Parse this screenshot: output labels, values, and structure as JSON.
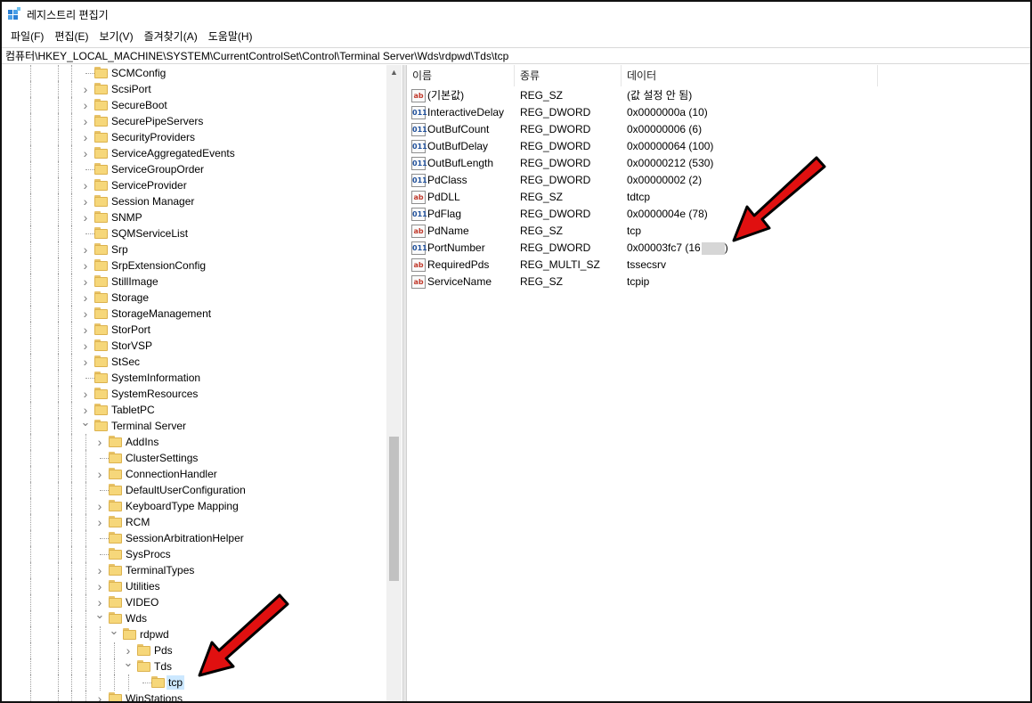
{
  "window": {
    "title": "레지스트리 편집기",
    "app_icon": "registry-editor-icon"
  },
  "menu": [
    "파일(F)",
    "편집(E)",
    "보기(V)",
    "즐겨찾기(A)",
    "도움말(H)"
  ],
  "address": "컴퓨터\\HKEY_LOCAL_MACHINE\\SYSTEM\\CurrentControlSet\\Control\\Terminal Server\\Wds\\rdpwd\\Tds\\tcp",
  "tree": [
    {
      "label": "SCMConfig",
      "depth": 0,
      "expander": "none"
    },
    {
      "label": "ScsiPort",
      "depth": 0,
      "expander": "collapsed"
    },
    {
      "label": "SecureBoot",
      "depth": 0,
      "expander": "collapsed"
    },
    {
      "label": "SecurePipeServers",
      "depth": 0,
      "expander": "collapsed"
    },
    {
      "label": "SecurityProviders",
      "depth": 0,
      "expander": "collapsed"
    },
    {
      "label": "ServiceAggregatedEvents",
      "depth": 0,
      "expander": "collapsed"
    },
    {
      "label": "ServiceGroupOrder",
      "depth": 0,
      "expander": "none"
    },
    {
      "label": "ServiceProvider",
      "depth": 0,
      "expander": "collapsed"
    },
    {
      "label": "Session Manager",
      "depth": 0,
      "expander": "collapsed"
    },
    {
      "label": "SNMP",
      "depth": 0,
      "expander": "collapsed"
    },
    {
      "label": "SQMServiceList",
      "depth": 0,
      "expander": "none"
    },
    {
      "label": "Srp",
      "depth": 0,
      "expander": "collapsed"
    },
    {
      "label": "SrpExtensionConfig",
      "depth": 0,
      "expander": "collapsed"
    },
    {
      "label": "StillImage",
      "depth": 0,
      "expander": "collapsed"
    },
    {
      "label": "Storage",
      "depth": 0,
      "expander": "collapsed"
    },
    {
      "label": "StorageManagement",
      "depth": 0,
      "expander": "collapsed"
    },
    {
      "label": "StorPort",
      "depth": 0,
      "expander": "collapsed"
    },
    {
      "label": "StorVSP",
      "depth": 0,
      "expander": "collapsed"
    },
    {
      "label": "StSec",
      "depth": 0,
      "expander": "collapsed"
    },
    {
      "label": "SystemInformation",
      "depth": 0,
      "expander": "none"
    },
    {
      "label": "SystemResources",
      "depth": 0,
      "expander": "collapsed"
    },
    {
      "label": "TabletPC",
      "depth": 0,
      "expander": "collapsed"
    },
    {
      "label": "Terminal Server",
      "depth": 0,
      "expander": "expanded"
    },
    {
      "label": "AddIns",
      "depth": 1,
      "expander": "collapsed"
    },
    {
      "label": "ClusterSettings",
      "depth": 1,
      "expander": "none"
    },
    {
      "label": "ConnectionHandler",
      "depth": 1,
      "expander": "collapsed"
    },
    {
      "label": "DefaultUserConfiguration",
      "depth": 1,
      "expander": "none"
    },
    {
      "label": "KeyboardType Mapping",
      "depth": 1,
      "expander": "collapsed"
    },
    {
      "label": "RCM",
      "depth": 1,
      "expander": "collapsed"
    },
    {
      "label": "SessionArbitrationHelper",
      "depth": 1,
      "expander": "none"
    },
    {
      "label": "SysProcs",
      "depth": 1,
      "expander": "none"
    },
    {
      "label": "TerminalTypes",
      "depth": 1,
      "expander": "collapsed"
    },
    {
      "label": "Utilities",
      "depth": 1,
      "expander": "collapsed"
    },
    {
      "label": "VIDEO",
      "depth": 1,
      "expander": "collapsed"
    },
    {
      "label": "Wds",
      "depth": 1,
      "expander": "expanded"
    },
    {
      "label": "rdpwd",
      "depth": 2,
      "expander": "expanded"
    },
    {
      "label": "Pds",
      "depth": 3,
      "expander": "collapsed"
    },
    {
      "label": "Tds",
      "depth": 3,
      "expander": "expanded"
    },
    {
      "label": "tcp",
      "depth": 4,
      "expander": "none",
      "selected": true
    },
    {
      "label": "WinStations",
      "depth": 1,
      "expander": "collapsed"
    }
  ],
  "columns": {
    "name": "이름",
    "type": "종류",
    "data": "데이터"
  },
  "values": [
    {
      "icon": "string",
      "name": "(기본값)",
      "type": "REG_SZ",
      "data": "(값 설정 안 됨)"
    },
    {
      "icon": "binary",
      "name": "InteractiveDelay",
      "type": "REG_DWORD",
      "data": "0x0000000a (10)"
    },
    {
      "icon": "binary",
      "name": "OutBufCount",
      "type": "REG_DWORD",
      "data": "0x00000006 (6)"
    },
    {
      "icon": "binary",
      "name": "OutBufDelay",
      "type": "REG_DWORD",
      "data": "0x00000064 (100)"
    },
    {
      "icon": "binary",
      "name": "OutBufLength",
      "type": "REG_DWORD",
      "data": "0x00000212 (530)"
    },
    {
      "icon": "binary",
      "name": "PdClass",
      "type": "REG_DWORD",
      "data": "0x00000002 (2)"
    },
    {
      "icon": "string",
      "name": "PdDLL",
      "type": "REG_SZ",
      "data": "tdtcp"
    },
    {
      "icon": "binary",
      "name": "PdFlag",
      "type": "REG_DWORD",
      "data": "0x0000004e (78)"
    },
    {
      "icon": "string",
      "name": "PdName",
      "type": "REG_SZ",
      "data": "tcp"
    },
    {
      "icon": "binary",
      "name": "PortNumber",
      "type": "REG_DWORD",
      "data": "0x00003fc7 (16",
      "redacted_tail": ")"
    },
    {
      "icon": "string",
      "name": "RequiredPds",
      "type": "REG_MULTI_SZ",
      "data": "tssecsrv"
    },
    {
      "icon": "string",
      "name": "ServiceName",
      "type": "REG_SZ",
      "data": "tcpip"
    }
  ],
  "icon_glyphs": {
    "string": "ab",
    "binary": "011"
  },
  "colors": {
    "arrow": "#e01010",
    "selection": "#cce8ff",
    "folder": "#f6d77a"
  }
}
